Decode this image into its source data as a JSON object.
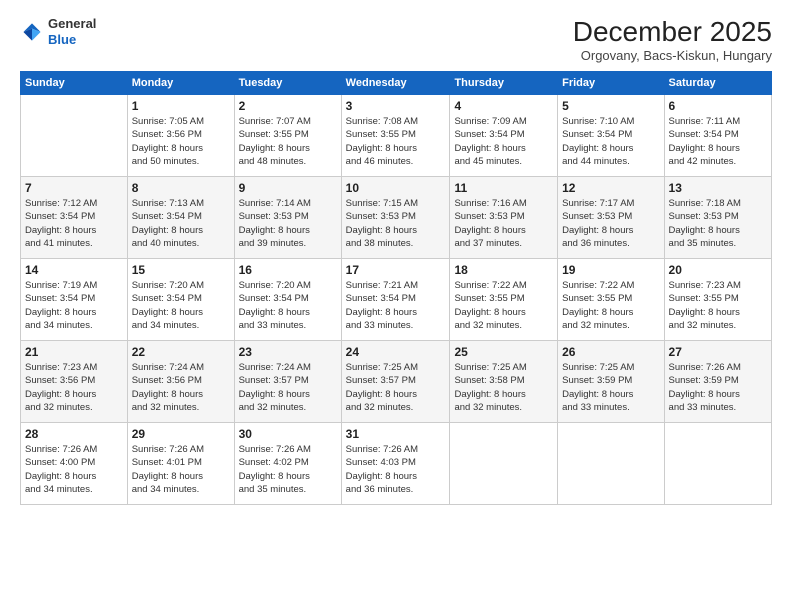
{
  "header": {
    "logo_line1": "General",
    "logo_line2": "Blue",
    "month_title": "December 2025",
    "subtitle": "Orgovany, Bacs-Kiskun, Hungary"
  },
  "weekdays": [
    "Sunday",
    "Monday",
    "Tuesday",
    "Wednesday",
    "Thursday",
    "Friday",
    "Saturday"
  ],
  "weeks": [
    [
      {
        "day": "",
        "sunrise": "",
        "sunset": "",
        "daylight": ""
      },
      {
        "day": "1",
        "sunrise": "Sunrise: 7:05 AM",
        "sunset": "Sunset: 3:56 PM",
        "daylight": "Daylight: 8 hours and 50 minutes."
      },
      {
        "day": "2",
        "sunrise": "Sunrise: 7:07 AM",
        "sunset": "Sunset: 3:55 PM",
        "daylight": "Daylight: 8 hours and 48 minutes."
      },
      {
        "day": "3",
        "sunrise": "Sunrise: 7:08 AM",
        "sunset": "Sunset: 3:55 PM",
        "daylight": "Daylight: 8 hours and 46 minutes."
      },
      {
        "day": "4",
        "sunrise": "Sunrise: 7:09 AM",
        "sunset": "Sunset: 3:54 PM",
        "daylight": "Daylight: 8 hours and 45 minutes."
      },
      {
        "day": "5",
        "sunrise": "Sunrise: 7:10 AM",
        "sunset": "Sunset: 3:54 PM",
        "daylight": "Daylight: 8 hours and 44 minutes."
      },
      {
        "day": "6",
        "sunrise": "Sunrise: 7:11 AM",
        "sunset": "Sunset: 3:54 PM",
        "daylight": "Daylight: 8 hours and 42 minutes."
      }
    ],
    [
      {
        "day": "7",
        "sunrise": "Sunrise: 7:12 AM",
        "sunset": "Sunset: 3:54 PM",
        "daylight": "Daylight: 8 hours and 41 minutes."
      },
      {
        "day": "8",
        "sunrise": "Sunrise: 7:13 AM",
        "sunset": "Sunset: 3:54 PM",
        "daylight": "Daylight: 8 hours and 40 minutes."
      },
      {
        "day": "9",
        "sunrise": "Sunrise: 7:14 AM",
        "sunset": "Sunset: 3:53 PM",
        "daylight": "Daylight: 8 hours and 39 minutes."
      },
      {
        "day": "10",
        "sunrise": "Sunrise: 7:15 AM",
        "sunset": "Sunset: 3:53 PM",
        "daylight": "Daylight: 8 hours and 38 minutes."
      },
      {
        "day": "11",
        "sunrise": "Sunrise: 7:16 AM",
        "sunset": "Sunset: 3:53 PM",
        "daylight": "Daylight: 8 hours and 37 minutes."
      },
      {
        "day": "12",
        "sunrise": "Sunrise: 7:17 AM",
        "sunset": "Sunset: 3:53 PM",
        "daylight": "Daylight: 8 hours and 36 minutes."
      },
      {
        "day": "13",
        "sunrise": "Sunrise: 7:18 AM",
        "sunset": "Sunset: 3:53 PM",
        "daylight": "Daylight: 8 hours and 35 minutes."
      }
    ],
    [
      {
        "day": "14",
        "sunrise": "Sunrise: 7:19 AM",
        "sunset": "Sunset: 3:54 PM",
        "daylight": "Daylight: 8 hours and 34 minutes."
      },
      {
        "day": "15",
        "sunrise": "Sunrise: 7:20 AM",
        "sunset": "Sunset: 3:54 PM",
        "daylight": "Daylight: 8 hours and 34 minutes."
      },
      {
        "day": "16",
        "sunrise": "Sunrise: 7:20 AM",
        "sunset": "Sunset: 3:54 PM",
        "daylight": "Daylight: 8 hours and 33 minutes."
      },
      {
        "day": "17",
        "sunrise": "Sunrise: 7:21 AM",
        "sunset": "Sunset: 3:54 PM",
        "daylight": "Daylight: 8 hours and 33 minutes."
      },
      {
        "day": "18",
        "sunrise": "Sunrise: 7:22 AM",
        "sunset": "Sunset: 3:55 PM",
        "daylight": "Daylight: 8 hours and 32 minutes."
      },
      {
        "day": "19",
        "sunrise": "Sunrise: 7:22 AM",
        "sunset": "Sunset: 3:55 PM",
        "daylight": "Daylight: 8 hours and 32 minutes."
      },
      {
        "day": "20",
        "sunrise": "Sunrise: 7:23 AM",
        "sunset": "Sunset: 3:55 PM",
        "daylight": "Daylight: 8 hours and 32 minutes."
      }
    ],
    [
      {
        "day": "21",
        "sunrise": "Sunrise: 7:23 AM",
        "sunset": "Sunset: 3:56 PM",
        "daylight": "Daylight: 8 hours and 32 minutes."
      },
      {
        "day": "22",
        "sunrise": "Sunrise: 7:24 AM",
        "sunset": "Sunset: 3:56 PM",
        "daylight": "Daylight: 8 hours and 32 minutes."
      },
      {
        "day": "23",
        "sunrise": "Sunrise: 7:24 AM",
        "sunset": "Sunset: 3:57 PM",
        "daylight": "Daylight: 8 hours and 32 minutes."
      },
      {
        "day": "24",
        "sunrise": "Sunrise: 7:25 AM",
        "sunset": "Sunset: 3:57 PM",
        "daylight": "Daylight: 8 hours and 32 minutes."
      },
      {
        "day": "25",
        "sunrise": "Sunrise: 7:25 AM",
        "sunset": "Sunset: 3:58 PM",
        "daylight": "Daylight: 8 hours and 32 minutes."
      },
      {
        "day": "26",
        "sunrise": "Sunrise: 7:25 AM",
        "sunset": "Sunset: 3:59 PM",
        "daylight": "Daylight: 8 hours and 33 minutes."
      },
      {
        "day": "27",
        "sunrise": "Sunrise: 7:26 AM",
        "sunset": "Sunset: 3:59 PM",
        "daylight": "Daylight: 8 hours and 33 minutes."
      }
    ],
    [
      {
        "day": "28",
        "sunrise": "Sunrise: 7:26 AM",
        "sunset": "Sunset: 4:00 PM",
        "daylight": "Daylight: 8 hours and 34 minutes."
      },
      {
        "day": "29",
        "sunrise": "Sunrise: 7:26 AM",
        "sunset": "Sunset: 4:01 PM",
        "daylight": "Daylight: 8 hours and 34 minutes."
      },
      {
        "day": "30",
        "sunrise": "Sunrise: 7:26 AM",
        "sunset": "Sunset: 4:02 PM",
        "daylight": "Daylight: 8 hours and 35 minutes."
      },
      {
        "day": "31",
        "sunrise": "Sunrise: 7:26 AM",
        "sunset": "Sunset: 4:03 PM",
        "daylight": "Daylight: 8 hours and 36 minutes."
      },
      {
        "day": "",
        "sunrise": "",
        "sunset": "",
        "daylight": ""
      },
      {
        "day": "",
        "sunrise": "",
        "sunset": "",
        "daylight": ""
      },
      {
        "day": "",
        "sunrise": "",
        "sunset": "",
        "daylight": ""
      }
    ]
  ]
}
